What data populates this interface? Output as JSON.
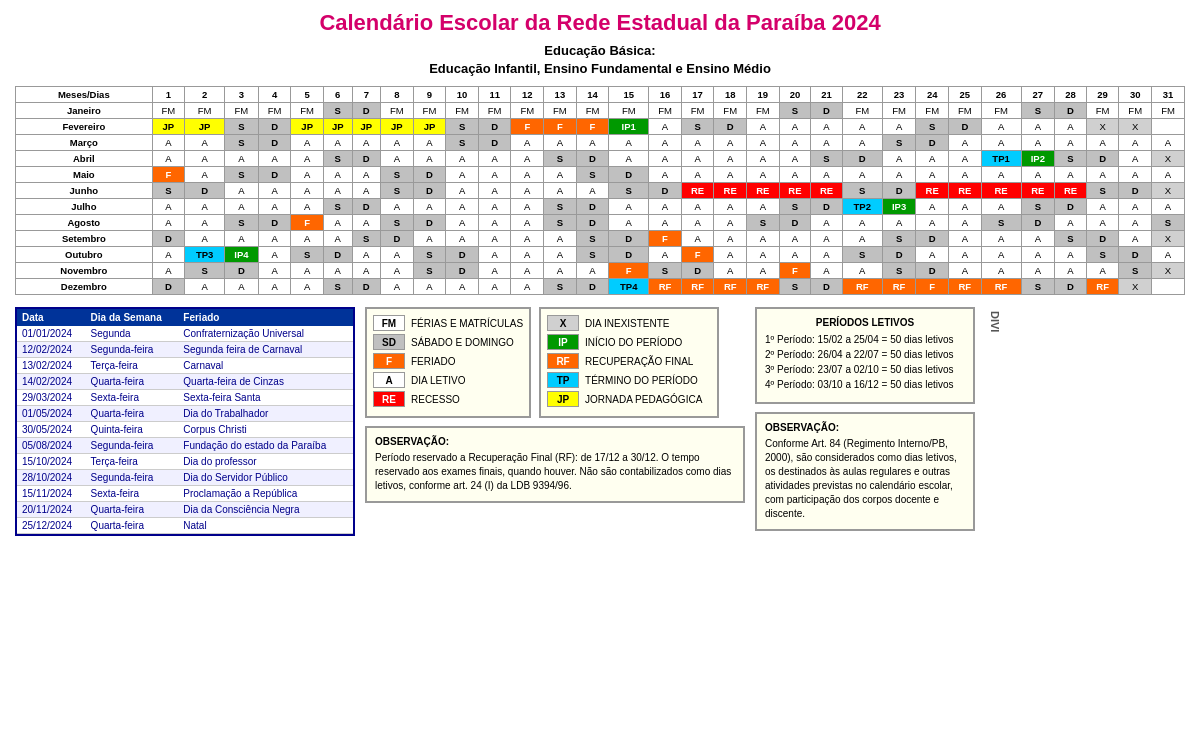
{
  "title": "Calendário Escolar da Rede Estadual da Paraíba 2024",
  "subtitle_line1": "Educação Básica:",
  "subtitle_line2": "Educação Infantil, Ensino Fundamental e Ensino Médio",
  "calendar": {
    "headers": [
      "Meses/Dias",
      "1",
      "2",
      "3",
      "4",
      "5",
      "6",
      "7",
      "8",
      "9",
      "10",
      "11",
      "12",
      "13",
      "14",
      "15",
      "16",
      "17",
      "18",
      "19",
      "20",
      "21",
      "22",
      "23",
      "24",
      "25",
      "26",
      "27",
      "28",
      "29",
      "30",
      "31"
    ],
    "rows": [
      {
        "month": "Janeiro",
        "cells": [
          "FM",
          "FM",
          "FM",
          "FM",
          "FM",
          "S",
          "D",
          "FM",
          "FM",
          "FM",
          "FM",
          "FM",
          "FM",
          "FM",
          "FM",
          "FM",
          "FM",
          "FM",
          "FM",
          "S",
          "D",
          "FM",
          "FM",
          "FM",
          "FM",
          "FM",
          "S",
          "D",
          "FM",
          "FM",
          "FM"
        ]
      },
      {
        "month": "Fevereiro",
        "cells": [
          "JP",
          "JP",
          "S",
          "D",
          "JP",
          "JP",
          "JP",
          "JP",
          "JP",
          "S",
          "D",
          "F",
          "F",
          "F",
          "IP1",
          "A",
          "S",
          "D",
          "A",
          "A",
          "A",
          "A",
          "A",
          "S",
          "D",
          "A",
          "A",
          "A",
          "X",
          "X",
          ""
        ]
      },
      {
        "month": "Março",
        "cells": [
          "A",
          "A",
          "S",
          "D",
          "A",
          "A",
          "A",
          "A",
          "A",
          "S",
          "D",
          "A",
          "A",
          "A",
          "A",
          "A",
          "A",
          "A",
          "A",
          "A",
          "A",
          "A",
          "S",
          "D",
          "A",
          "A",
          "A",
          "A",
          "A",
          "A",
          "A"
        ]
      },
      {
        "month": "Abril",
        "cells": [
          "A",
          "A",
          "A",
          "A",
          "A",
          "S",
          "D",
          "A",
          "A",
          "A",
          "A",
          "A",
          "S",
          "D",
          "A",
          "A",
          "A",
          "A",
          "A",
          "A",
          "S",
          "D",
          "A",
          "A",
          "A",
          "TP1",
          "IP2",
          "S",
          "D",
          "A",
          "X"
        ]
      },
      {
        "month": "Maio",
        "cells": [
          "F",
          "A",
          "S",
          "D",
          "A",
          "A",
          "A",
          "S",
          "D",
          "A",
          "A",
          "A",
          "A",
          "S",
          "D",
          "A",
          "A",
          "A",
          "A",
          "A",
          "A",
          "A",
          "A",
          "A",
          "A",
          "A",
          "A",
          "A",
          "A",
          "A",
          "A"
        ]
      },
      {
        "month": "Junho",
        "cells": [
          "S",
          "D",
          "A",
          "A",
          "A",
          "A",
          "A",
          "S",
          "D",
          "A",
          "A",
          "A",
          "A",
          "A",
          "S",
          "D",
          "RE",
          "RE",
          "RE",
          "RE",
          "RE",
          "S",
          "D",
          "RE",
          "RE",
          "RE",
          "RE",
          "RE",
          "S",
          "D",
          "X"
        ]
      },
      {
        "month": "Julho",
        "cells": [
          "A",
          "A",
          "A",
          "A",
          "A",
          "S",
          "D",
          "A",
          "A",
          "A",
          "A",
          "A",
          "S",
          "D",
          "A",
          "A",
          "A",
          "A",
          "A",
          "S",
          "D",
          "TP2",
          "IP3",
          "A",
          "A",
          "A",
          "S",
          "D",
          "A",
          "A",
          "A"
        ]
      },
      {
        "month": "Agosto",
        "cells": [
          "A",
          "A",
          "S",
          "D",
          "F",
          "A",
          "A",
          "S",
          "D",
          "A",
          "A",
          "A",
          "S",
          "D",
          "A",
          "A",
          "A",
          "A",
          "S",
          "D",
          "A",
          "A",
          "A",
          "A",
          "A",
          "S",
          "D",
          "A",
          "A",
          "A",
          "S"
        ]
      },
      {
        "month": "Setembro",
        "cells": [
          "D",
          "A",
          "A",
          "A",
          "A",
          "A",
          "S",
          "D",
          "A",
          "A",
          "A",
          "A",
          "A",
          "S",
          "D",
          "F",
          "A",
          "A",
          "A",
          "A",
          "A",
          "A",
          "S",
          "D",
          "A",
          "A",
          "A",
          "S",
          "D",
          "A",
          "X"
        ]
      },
      {
        "month": "Outubro",
        "cells": [
          "A",
          "TP3",
          "IP4",
          "A",
          "S",
          "D",
          "A",
          "A",
          "S",
          "D",
          "A",
          "A",
          "A",
          "S",
          "D",
          "A",
          "F",
          "A",
          "A",
          "A",
          "A",
          "S",
          "D",
          "A",
          "A",
          "A",
          "A",
          "A",
          "S",
          "D",
          "A"
        ]
      },
      {
        "month": "Novembro",
        "cells": [
          "A",
          "S",
          "D",
          "A",
          "A",
          "A",
          "A",
          "A",
          "S",
          "D",
          "A",
          "A",
          "A",
          "A",
          "F",
          "S",
          "D",
          "A",
          "A",
          "F",
          "A",
          "A",
          "S",
          "D",
          "A",
          "A",
          "A",
          "A",
          "A",
          "S",
          "X"
        ]
      },
      {
        "month": "Dezembro",
        "cells": [
          "D",
          "A",
          "A",
          "A",
          "A",
          "S",
          "D",
          "A",
          "A",
          "A",
          "A",
          "A",
          "S",
          "D",
          "TP4",
          "RF",
          "RF",
          "RF",
          "RF",
          "S",
          "D",
          "RF",
          "RF",
          "F",
          "RF",
          "RF",
          "S",
          "D",
          "RF",
          "X",
          ""
        ]
      }
    ]
  },
  "feriados": {
    "headers": [
      "Data",
      "Dia da Semana",
      "Feriado"
    ],
    "rows": [
      [
        "01/01/2024",
        "Segunda",
        "Confraternização Universal"
      ],
      [
        "12/02/2024",
        "Segunda-feira",
        "Segunda feira de Carnaval"
      ],
      [
        "13/02/2024",
        "Terça-feira",
        "Carnaval"
      ],
      [
        "14/02/2024",
        "Quarta-feira",
        "Quarta-feira de Cinzas"
      ],
      [
        "29/03/2024",
        "Sexta-feira",
        "Sexta-feira Santa"
      ],
      [
        "01/05/2024",
        "Quarta-feira",
        "Dia do Trabalhador"
      ],
      [
        "30/05/2024",
        "Quinta-feira",
        "Corpus Christi"
      ],
      [
        "05/08/2024",
        "Segunda-feira",
        "Fundação do estado da Paraíba"
      ],
      [
        "15/10/2024",
        "Terça-feira",
        "Dia do professor"
      ],
      [
        "28/10/2024",
        "Segunda-feira",
        "Dia do Servidor Público"
      ],
      [
        "15/11/2024",
        "Sexta-feira",
        "Proclamação a República"
      ],
      [
        "20/11/2024",
        "Quarta-feira",
        "Dia da Consciência Negra"
      ],
      [
        "25/12/2024",
        "Quarta-feira",
        "Natal"
      ]
    ]
  },
  "legend_left": {
    "items": [
      {
        "code": "FM",
        "color": "#ffffff",
        "text": "FÉRIAS E MATRÍCULAS",
        "border": "#999"
      },
      {
        "code": "SD",
        "color": "#c0c0c0",
        "text": "SÁBADO E DOMINGO",
        "border": "#999"
      },
      {
        "code": "F",
        "color": "#ff6600",
        "text": "FERIADO",
        "border": "#999",
        "textColor": "#fff"
      },
      {
        "code": "A",
        "color": "#ffffff",
        "text": "DIA LETIVO",
        "border": "#999"
      },
      {
        "code": "RE",
        "color": "#ff0000",
        "text": "RECESSO",
        "border": "#999",
        "textColor": "#fff"
      }
    ]
  },
  "legend_right": {
    "items": [
      {
        "code": "X",
        "color": "#d0d0d0",
        "text": "DIA INEXISTENTE",
        "border": "#999"
      },
      {
        "code": "IP",
        "color": "#009900",
        "text": "INÍCIO DO PERÍODO",
        "border": "#999",
        "textColor": "#fff"
      },
      {
        "code": "RF",
        "color": "#ff6600",
        "text": "RECUPERAÇÃO FINAL",
        "border": "#999",
        "textColor": "#fff"
      },
      {
        "code": "TP",
        "color": "#00ccff",
        "text": "TÉRMINO DO PERÍODO",
        "border": "#999"
      },
      {
        "code": "JP",
        "color": "#ffff00",
        "text": "JORNADA PEDAGÓGICA",
        "border": "#999"
      }
    ]
  },
  "periods": {
    "title": "PERÍODOS LETIVOS",
    "items": [
      "1º Período: 15/02 a 25/04 = 50 dias letivos",
      "2º Período: 26/04 a 22/07 = 50 dias letivos",
      "3º Período: 23/07 a 02/10 = 50 dias letivos",
      "4º Período: 03/10 a 16/12 = 50 dias letivos"
    ]
  },
  "obs1": {
    "title": "OBSERVAÇÃO:",
    "text": "Período reservado a Recuperação Final (RF): de 17/12 a 30/12.\nO tempo reservado aos exames finais, quando houver. Não são contabilizados como dias letivos, conforme art. 24 (I) da LDB 9394/96."
  },
  "obs2": {
    "title": "OBSERVAÇÃO:",
    "text": "Conforme Art. 84 (Regimento Interno/PB, 2000), são considerados como dias letivos, os destinados às aulas regulares e outras atividades previstas no calendário escolar, com participação dos corpos docente e discente."
  },
  "divi_label": "DIVI"
}
